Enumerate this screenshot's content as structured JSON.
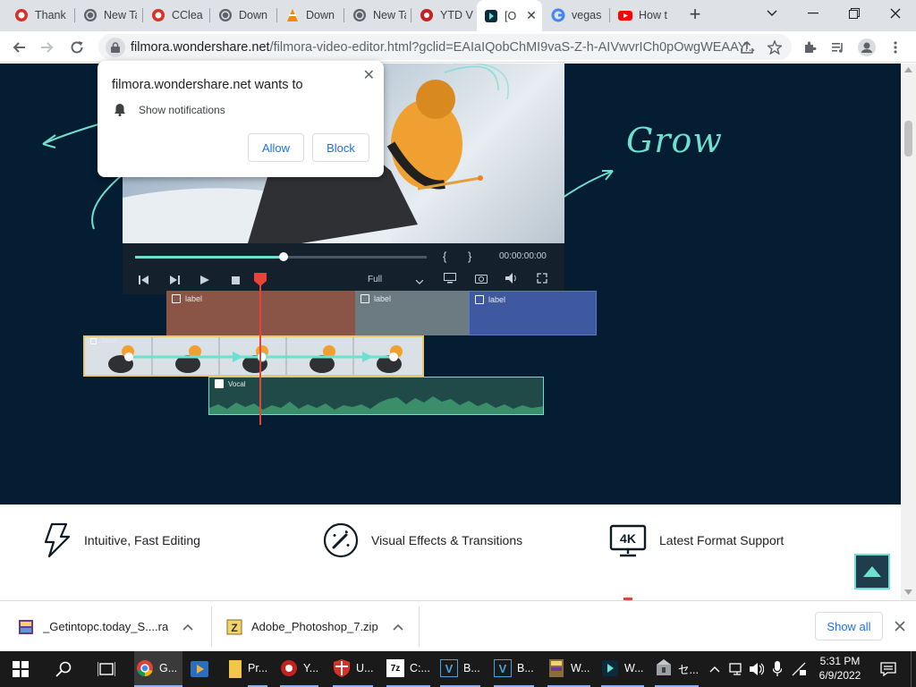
{
  "browser": {
    "tabs": [
      {
        "label": "Thank",
        "icon": "ccleaner-icon"
      },
      {
        "label": "New Ta",
        "icon": "globe-icon"
      },
      {
        "label": "CClea",
        "icon": "ccleaner-icon"
      },
      {
        "label": "Down",
        "icon": "globe-icon"
      },
      {
        "label": "Down",
        "icon": "vlc-icon"
      },
      {
        "label": "New Ta",
        "icon": "globe-icon"
      },
      {
        "label": "YTD V",
        "icon": "ytd-icon"
      },
      {
        "label": "[O",
        "icon": "filmora-icon",
        "active": true
      },
      {
        "label": "vegas",
        "icon": "google-icon"
      },
      {
        "label": "How t",
        "icon": "youtube-icon"
      }
    ],
    "new_tab": "+",
    "url_host": "filmora.wondershare.net",
    "url_path": "/filmora-video-editor.html?gclid=EAIaIQobChMI9vaS-Z-h-AIVwvrICh0pOwgWEAAY..."
  },
  "notification_popup": {
    "title": "filmora.wondershare.net wants to",
    "permission": "Show notifications",
    "allow": "Allow",
    "block": "Block"
  },
  "hero": {
    "grow_text": "Grow",
    "timecode": "00:00:00:00",
    "quality": "Full",
    "brace_open": "{",
    "brace_close": "}",
    "tracks": {
      "label_1": "label",
      "label_2": "label",
      "label_3": "label",
      "video_title": "Titled",
      "audio": "Vocal"
    }
  },
  "features": [
    {
      "label": "Intuitive, Fast Editing",
      "icon": "lightning-icon"
    },
    {
      "label": "Visual Effects & Transitions",
      "icon": "magic-wand-icon"
    },
    {
      "label": "Latest Format Support",
      "icon": "4k-monitor-icon"
    }
  ],
  "downloads": {
    "items": [
      {
        "name": "_Getintopc.today_S....rar",
        "icon": "winrar-icon"
      },
      {
        "name": "Adobe_Photoshop_7.zip",
        "icon": "winzip-icon"
      }
    ],
    "show_all": "Show all"
  },
  "taskbar": {
    "apps": [
      {
        "label": "G...",
        "icon": "chrome-icon"
      },
      {
        "label": "",
        "icon": "media-player-icon"
      },
      {
        "label": "",
        "icon": "file-explorer-icon"
      },
      {
        "label": "Pr...",
        "icon": "folder-icon"
      },
      {
        "label": "Y...",
        "icon": "ytd-icon"
      },
      {
        "label": "U...",
        "icon": "shield-icon"
      },
      {
        "label": "C:...",
        "icon": "7zip-icon"
      },
      {
        "label": "B...",
        "icon": "vegas-icon"
      },
      {
        "label": "B...",
        "icon": "vegas-icon"
      },
      {
        "label": "W...",
        "icon": "winrar-icon"
      },
      {
        "label": "W...",
        "icon": "filmora-icon"
      },
      {
        "label": "セ...",
        "icon": "setup-icon"
      }
    ],
    "sevenzip_text": "7z",
    "vegas_text": "V",
    "time": "5:31 PM",
    "date": "6/9/2022"
  },
  "colors": {
    "hero_bg": "#041d32",
    "accent": "#6ee0cf",
    "playhead": "#e8423a",
    "link": "#1a73e8"
  }
}
